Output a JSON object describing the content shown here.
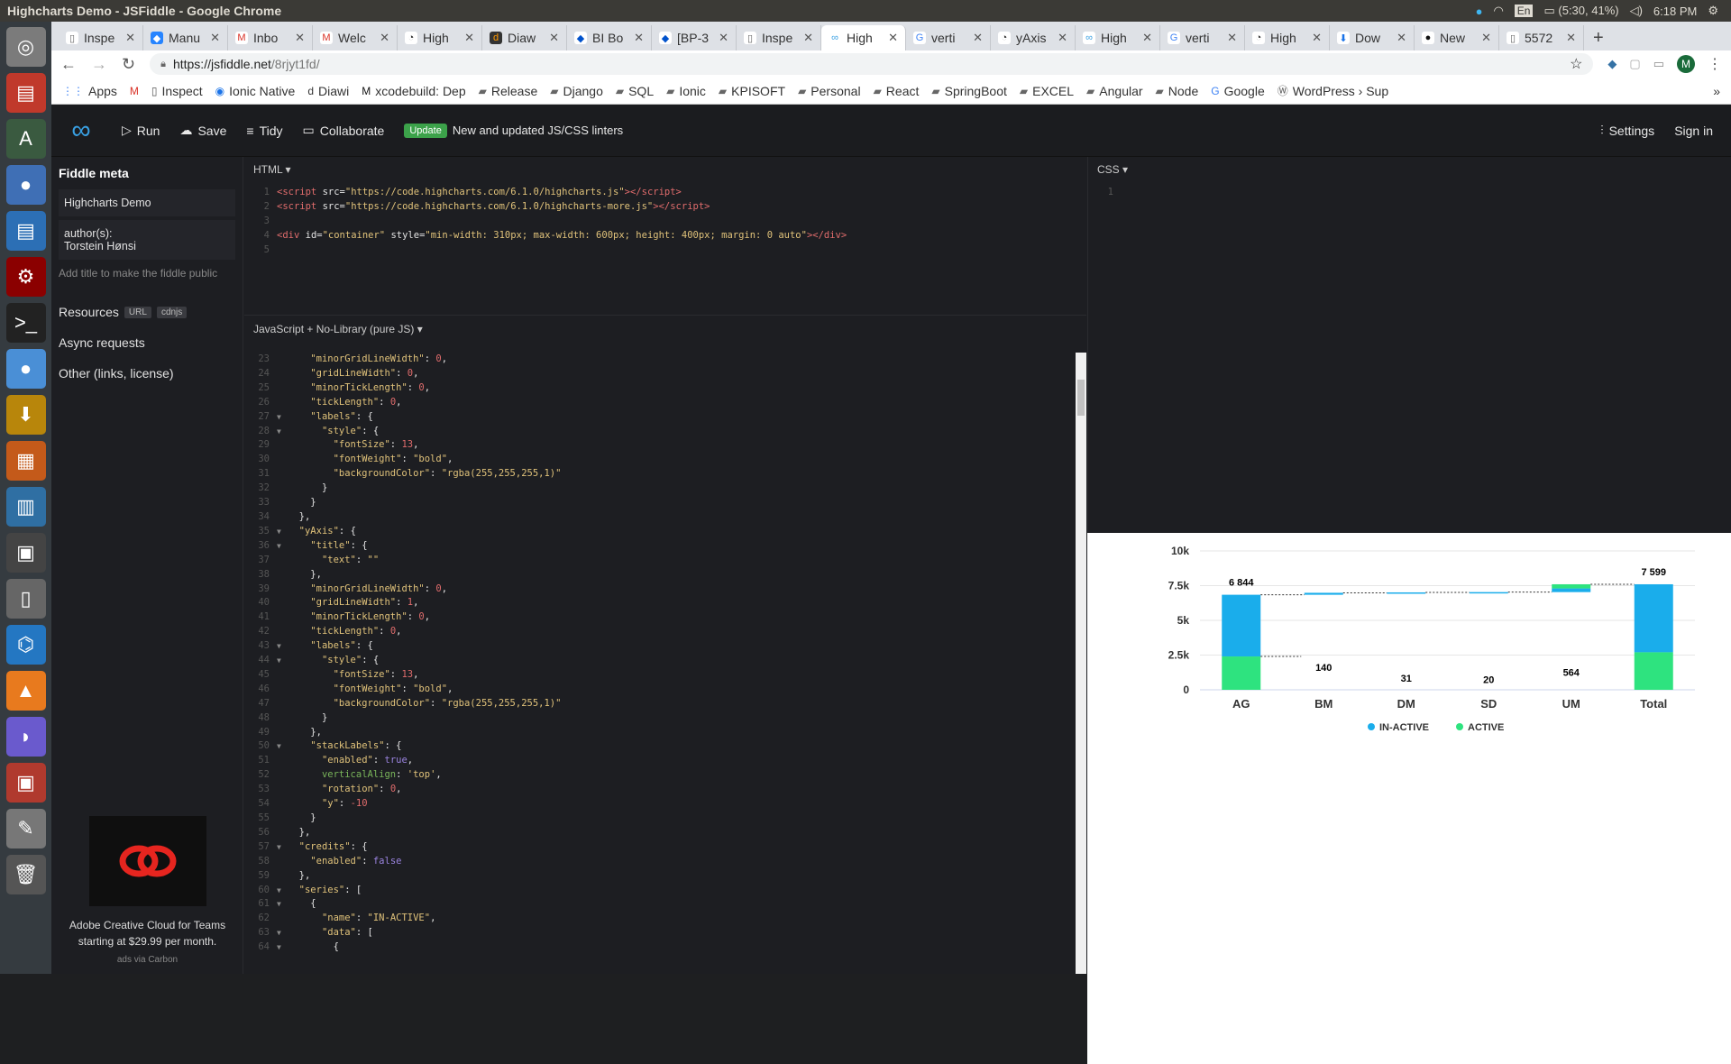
{
  "window_title": "Highcharts Demo - JSFiddle - Google Chrome",
  "system": {
    "lang": "En",
    "battery": "(5:30, 41%)",
    "time": "6:18 PM"
  },
  "launcher_icons": [
    "ubuntu-dash-icon",
    "files-icon",
    "software-updater-icon",
    "chrome-icon",
    "document-viewer-icon",
    "settings-icon",
    "terminal-icon",
    "chromium-icon",
    "archive-manager-icon",
    "impress-icon",
    "mysql-workbench-icon",
    "screenshot-icon",
    "usb-creator-icon",
    "vscode-icon",
    "vlc-icon",
    "dolphin-icon",
    "remmina-icon",
    "text-editor-icon",
    "trash-icon"
  ],
  "tabs": [
    {
      "label": "Inspe",
      "fav": "doc-icon"
    },
    {
      "label": "Manu",
      "fav": "jira-icon"
    },
    {
      "label": "Inbo",
      "fav": "gmail-icon"
    },
    {
      "label": "Welc",
      "fav": "gmail-icon"
    },
    {
      "label": "High",
      "fav": "highcharts-icon"
    },
    {
      "label": "Diaw",
      "fav": "diawi-icon"
    },
    {
      "label": "BI Bo",
      "fav": "confluence-icon"
    },
    {
      "label": "[BP-3",
      "fav": "confluence-icon"
    },
    {
      "label": "Inspe",
      "fav": "doc-icon"
    },
    {
      "label": "High",
      "fav": "jsfiddle-icon",
      "active": true
    },
    {
      "label": "verti",
      "fav": "google-icon"
    },
    {
      "label": "yAxis",
      "fav": "highcharts-icon"
    },
    {
      "label": "High",
      "fav": "jsfiddle-icon"
    },
    {
      "label": "verti",
      "fav": "google-icon"
    },
    {
      "label": "High",
      "fav": "highcharts-icon"
    },
    {
      "label": "Dow",
      "fav": "download-icon"
    },
    {
      "label": "New",
      "fav": "github-icon"
    },
    {
      "label": "5572",
      "fav": "doc-icon"
    }
  ],
  "omnibox": {
    "url_host": "https://jsfiddle.net",
    "url_path": "/8rjyt1fd/",
    "profile": "M"
  },
  "bookmarks": [
    "Apps",
    "",
    "Inspect",
    "Ionic Native",
    "Diawi",
    "xcodebuild: Dep",
    "Release",
    "Django",
    "SQL",
    "Ionic",
    "KPISOFT",
    "Personal",
    "React",
    "SpringBoot",
    "EXCEL",
    "Angular",
    "Node",
    "Google",
    "WordPress › Sup"
  ],
  "jsfiddle_header": {
    "run": "Run",
    "save": "Save",
    "tidy": "Tidy",
    "collaborate": "Collaborate",
    "badge": "Update",
    "update_text": "New and updated JS/CSS linters",
    "settings": "Settings",
    "signin": "Sign in"
  },
  "meta": {
    "heading": "Fiddle meta",
    "title_value": "Highcharts Demo",
    "author_label": "author(s):",
    "author_value": "Torstein Hønsi",
    "hint": "Add title to make the fiddle public",
    "resources": "Resources",
    "res_url": "URL",
    "res_cdnjs": "cdnjs",
    "async": "Async requests",
    "other": "Other (links, license)",
    "ad_text": "Adobe Creative Cloud for Teams starting at $29.99 per month.",
    "ad_via": "ads via Carbon"
  },
  "html_panel": {
    "label": "HTML ▾",
    "lines": [
      {
        "n": "1",
        "html": "<span class='t'>&lt;script</span> <span class='k'>src=</span><span class='s'>\"https://code.highcharts.com/6.1.0/highcharts.js\"</span><span class='t'>&gt;&lt;/script&gt;</span>"
      },
      {
        "n": "2",
        "html": "<span class='t'>&lt;script</span> <span class='k'>src=</span><span class='s'>\"https://code.highcharts.com/6.1.0/highcharts-more.js\"</span><span class='t'>&gt;&lt;/script&gt;</span>"
      },
      {
        "n": "3",
        "html": ""
      },
      {
        "n": "4",
        "html": "<span class='t'>&lt;div</span> <span class='k'>id=</span><span class='s'>\"container\"</span> <span class='k'>style=</span><span class='s'>\"min-width: 310px; max-width: 600px; height: 400px; margin: 0 auto\"</span><span class='t'>&gt;&lt;/div&gt;</span>"
      },
      {
        "n": "5",
        "html": ""
      }
    ]
  },
  "css_panel": {
    "label": "CSS ▾",
    "line1": "1"
  },
  "js_panel": {
    "label": "JavaScript + No-Library (pure JS) ▾",
    "lines": [
      {
        "n": "23",
        "f": "",
        "html": "    <span class='s'>\"minorGridLineWidth\"</span><span class='k'>: </span><span class='n'>0</span><span class='k'>,</span>"
      },
      {
        "n": "24",
        "f": "",
        "html": "    <span class='s'>\"gridLineWidth\"</span><span class='k'>: </span><span class='n'>0</span><span class='k'>,</span>"
      },
      {
        "n": "25",
        "f": "",
        "html": "    <span class='s'>\"minorTickLength\"</span><span class='k'>: </span><span class='n'>0</span><span class='k'>,</span>"
      },
      {
        "n": "26",
        "f": "",
        "html": "    <span class='s'>\"tickLength\"</span><span class='k'>: </span><span class='n'>0</span><span class='k'>,</span>"
      },
      {
        "n": "27",
        "f": "▼",
        "html": "    <span class='s'>\"labels\"</span><span class='k'>: {</span>"
      },
      {
        "n": "28",
        "f": "▼",
        "html": "      <span class='s'>\"style\"</span><span class='k'>: {</span>"
      },
      {
        "n": "29",
        "f": "",
        "html": "        <span class='s'>\"fontSize\"</span><span class='k'>: </span><span class='n'>13</span><span class='k'>,</span>"
      },
      {
        "n": "30",
        "f": "",
        "html": "        <span class='s'>\"fontWeight\"</span><span class='k'>: </span><span class='s'>\"bold\"</span><span class='k'>,</span>"
      },
      {
        "n": "31",
        "f": "",
        "html": "        <span class='s'>\"backgroundColor\"</span><span class='k'>: </span><span class='s'>\"rgba(255,255,255,1)\"</span>"
      },
      {
        "n": "32",
        "f": "",
        "html": "      <span class='k'>}</span>"
      },
      {
        "n": "33",
        "f": "",
        "html": "    <span class='k'>}</span>"
      },
      {
        "n": "34",
        "f": "",
        "html": "  <span class='k'>},</span>"
      },
      {
        "n": "35",
        "f": "▼",
        "html": "  <span class='s'>\"yAxis\"</span><span class='k'>: {</span>"
      },
      {
        "n": "36",
        "f": "▼",
        "html": "    <span class='s'>\"title\"</span><span class='k'>: {</span>"
      },
      {
        "n": "37",
        "f": "",
        "html": "      <span class='s'>\"text\"</span><span class='k'>: </span><span class='s'>\"\"</span>"
      },
      {
        "n": "38",
        "f": "",
        "html": "    <span class='k'>},</span>"
      },
      {
        "n": "39",
        "f": "",
        "html": "    <span class='s'>\"minorGridLineWidth\"</span><span class='k'>: </span><span class='n'>0</span><span class='k'>,</span>"
      },
      {
        "n": "40",
        "f": "",
        "html": "    <span class='s'>\"gridLineWidth\"</span><span class='k'>: </span><span class='n'>1</span><span class='k'>,</span>"
      },
      {
        "n": "41",
        "f": "",
        "html": "    <span class='s'>\"minorTickLength\"</span><span class='k'>: </span><span class='n'>0</span><span class='k'>,</span>"
      },
      {
        "n": "42",
        "f": "",
        "html": "    <span class='s'>\"tickLength\"</span><span class='k'>: </span><span class='n'>0</span><span class='k'>,</span>"
      },
      {
        "n": "43",
        "f": "▼",
        "html": "    <span class='s'>\"labels\"</span><span class='k'>: {</span>"
      },
      {
        "n": "44",
        "f": "▼",
        "html": "      <span class='s'>\"style\"</span><span class='k'>: {</span>"
      },
      {
        "n": "45",
        "f": "",
        "html": "        <span class='s'>\"fontSize\"</span><span class='k'>: </span><span class='n'>13</span><span class='k'>,</span>"
      },
      {
        "n": "46",
        "f": "",
        "html": "        <span class='s'>\"fontWeight\"</span><span class='k'>: </span><span class='s'>\"bold\"</span><span class='k'>,</span>"
      },
      {
        "n": "47",
        "f": "",
        "html": "        <span class='s'>\"backgroundColor\"</span><span class='k'>: </span><span class='s'>\"rgba(255,255,255,1)\"</span>"
      },
      {
        "n": "48",
        "f": "",
        "html": "      <span class='k'>}</span>"
      },
      {
        "n": "49",
        "f": "",
        "html": "    <span class='k'>},</span>"
      },
      {
        "n": "50",
        "f": "▼",
        "html": "    <span class='s'>\"stackLabels\"</span><span class='k'>: {</span>"
      },
      {
        "n": "51",
        "f": "",
        "html": "      <span class='s'>\"enabled\"</span><span class='k'>: </span><span class='b'>true</span><span class='k'>,</span>"
      },
      {
        "n": "52",
        "f": "",
        "html": "      <span class='a'>verticalAlign</span><span class='k'>: </span><span class='s'>'top'</span><span class='k'>,</span>"
      },
      {
        "n": "53",
        "f": "",
        "html": "      <span class='s'>\"rotation\"</span><span class='k'>: </span><span class='n'>0</span><span class='k'>,</span>"
      },
      {
        "n": "54",
        "f": "",
        "html": "      <span class='s'>\"y\"</span><span class='k'>: </span><span class='n'>-10</span>"
      },
      {
        "n": "55",
        "f": "",
        "html": "    <span class='k'>}</span>"
      },
      {
        "n": "56",
        "f": "",
        "html": "  <span class='k'>},</span>"
      },
      {
        "n": "57",
        "f": "▼",
        "html": "  <span class='s'>\"credits\"</span><span class='k'>: {</span>"
      },
      {
        "n": "58",
        "f": "",
        "html": "    <span class='s'>\"enabled\"</span><span class='k'>: </span><span class='b'>false</span>"
      },
      {
        "n": "59",
        "f": "",
        "html": "  <span class='k'>},</span>"
      },
      {
        "n": "60",
        "f": "▼",
        "html": "  <span class='s'>\"series\"</span><span class='k'>: [</span>"
      },
      {
        "n": "61",
        "f": "▼",
        "html": "    <span class='k'>{</span>"
      },
      {
        "n": "62",
        "f": "",
        "html": "      <span class='s'>\"name\"</span><span class='k'>: </span><span class='s'>\"IN-ACTIVE\"</span><span class='k'>,</span>"
      },
      {
        "n": "63",
        "f": "▼",
        "html": "      <span class='s'>\"data\"</span><span class='k'>: [</span>"
      },
      {
        "n": "64",
        "f": "▼",
        "html": "        <span class='k'>{</span>"
      }
    ]
  },
  "chart_data": {
    "type": "bar",
    "categories": [
      "AG",
      "BM",
      "DM",
      "SD",
      "UM",
      "Total"
    ],
    "yticks": [
      "0",
      "2.5k",
      "5k",
      "7.5k",
      "10k"
    ],
    "ylim": [
      0,
      10000
    ],
    "stack_labels": [
      "6 844",
      "140",
      "31",
      "20",
      "564",
      "7 599"
    ],
    "series": [
      {
        "name": "IN-ACTIVE",
        "color": "#1aadeb",
        "segments": [
          [
            2400,
            6844
          ],
          [
            6844,
            6984
          ],
          [
            6984,
            7015
          ],
          [
            7015,
            7035
          ],
          [
            7035,
            7300
          ],
          [
            2700,
            7599
          ]
        ]
      },
      {
        "name": "ACTIVE",
        "color": "#2ee37f",
        "segments": [
          [
            0,
            2400
          ],
          null,
          null,
          null,
          [
            7300,
            7599
          ],
          [
            0,
            2700
          ]
        ]
      }
    ]
  }
}
